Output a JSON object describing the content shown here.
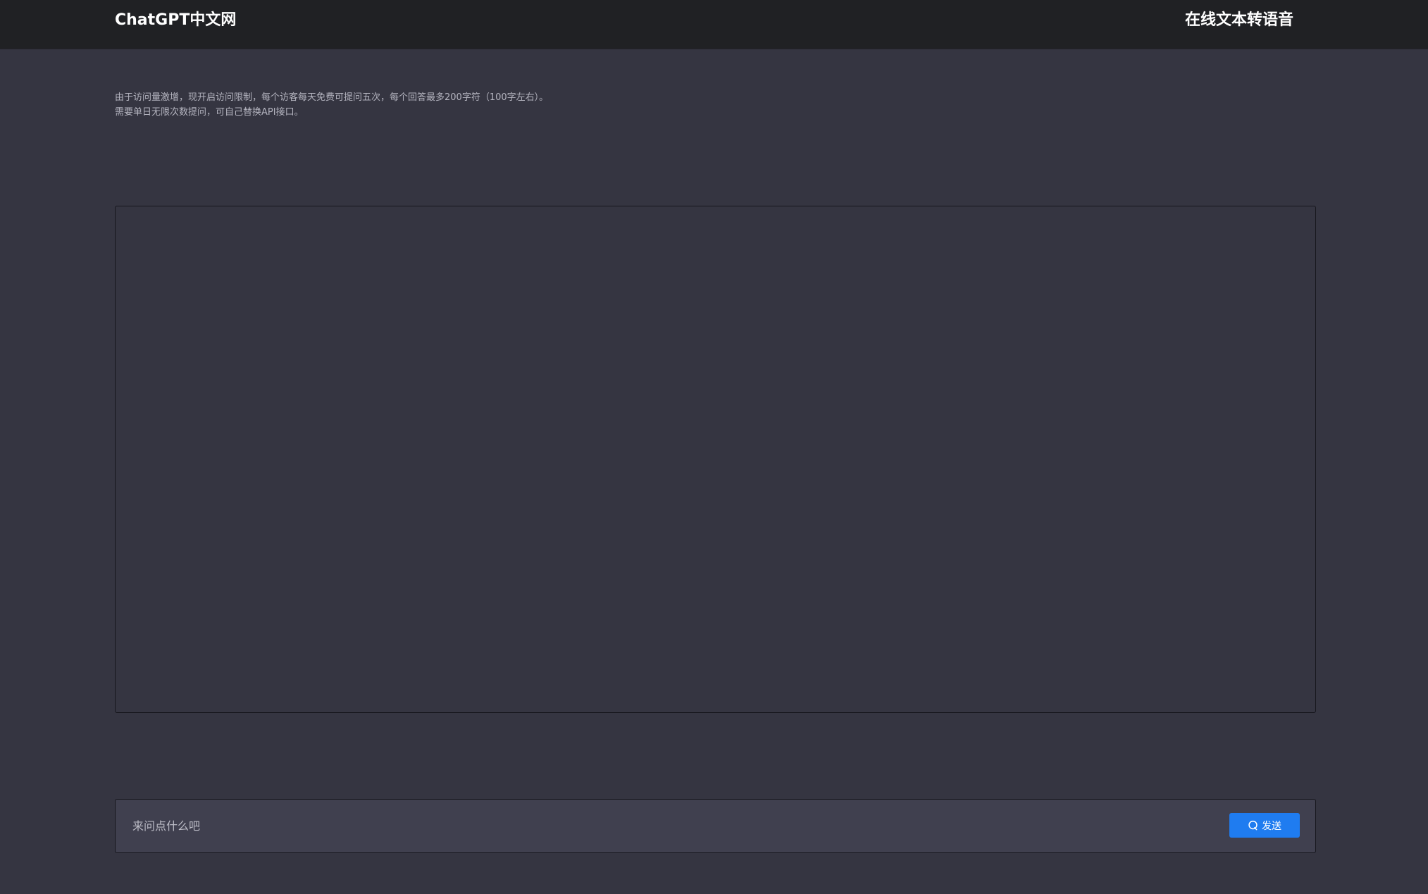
{
  "header": {
    "brand": "ChatGPT中文网",
    "nav_link": "在线文本转语音"
  },
  "notice": {
    "line1": "由于访问量激增，现开启访问限制，每个访客每天免费可提问五次，每个回答最多200字符（100字左右）。",
    "line2": "需要单日无限次数提问，可自己替换API接口。"
  },
  "input": {
    "placeholder": "来问点什么吧",
    "value": ""
  },
  "send_button": {
    "label": "发送",
    "icon": "chat-bubble-icon"
  },
  "colors": {
    "background": "#353541",
    "header": "#202124",
    "input_bar": "#40404f",
    "accent": "#1f7cf0"
  }
}
